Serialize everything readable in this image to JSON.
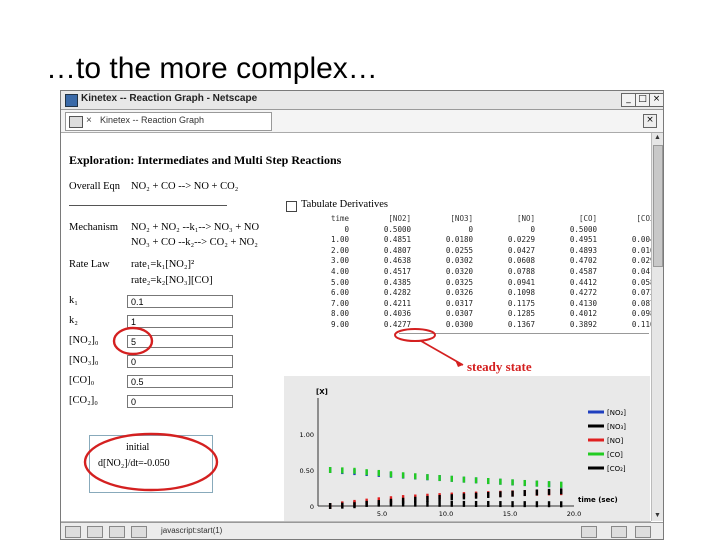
{
  "slide": {
    "title": "…to the more complex…"
  },
  "window": {
    "title": "Kinetex -- Reaction Graph - Netscape",
    "min": "_",
    "max": "□",
    "close": "×"
  },
  "tab": {
    "close": "×",
    "label": "Kinetex -- Reaction Graph",
    "closeall": "×"
  },
  "page": {
    "heading": "Exploration: Intermediates and Multi Step Reactions",
    "overall_label": "Overall Eqn",
    "overall_eqn": "NO₂ + CO --> NO + CO₂",
    "mechanism_label": "Mechanism",
    "mech1": "NO₂ + NO₂ --k₁--> NO₃ + NO",
    "mech2": "NO₃ + CO --k₂--> CO₂ + NO₂",
    "ratelaw_label": "Rate Law",
    "rate1": "rate₁=k₁[NO₂]²",
    "rate2": "rate₂=k₂[NO₃][CO]",
    "tabulate_label": "Tabulate Derivatives"
  },
  "inputs": [
    {
      "label": "k₁",
      "value": "0.1"
    },
    {
      "label": "k₂",
      "value": "1"
    },
    {
      "label": "[NO₂]₀",
      "value": "5"
    },
    {
      "label": "[NO₃]₀",
      "value": "0"
    },
    {
      "label": "[CO]₀",
      "value": "0.5"
    },
    {
      "label": "[CO₂]₀",
      "value": "0"
    }
  ],
  "table": {
    "headers": [
      "time",
      "[NO2]",
      "[NO3]",
      "[NO]",
      "[CO]",
      "[CO2]"
    ],
    "rows": [
      [
        "0",
        "0.5000",
        "0",
        "0",
        "0.5000",
        "0"
      ],
      [
        "1.00",
        "0.4851",
        "0.0180",
        "0.0229",
        "0.4951",
        "0.0049"
      ],
      [
        "2.00",
        "0.4807",
        "0.0255",
        "0.0427",
        "0.4893",
        "0.0107"
      ],
      [
        "3.00",
        "0.4638",
        "0.0302",
        "0.0608",
        "0.4702",
        "0.0298"
      ],
      [
        "4.00",
        "0.4517",
        "0.0320",
        "0.0788",
        "0.4587",
        "0.0413"
      ],
      [
        "5.00",
        "0.4385",
        "0.0325",
        "0.0941",
        "0.4412",
        "0.0588"
      ],
      [
        "6.00",
        "0.4282",
        "0.0326",
        "0.1098",
        "0.4272",
        "0.0728"
      ],
      [
        "7.00",
        "0.4211",
        "0.0317",
        "0.1175",
        "0.4130",
        "0.0870"
      ],
      [
        "8.00",
        "0.4036",
        "0.0307",
        "0.1285",
        "0.4012",
        "0.0988"
      ],
      [
        "9.00",
        "0.4277",
        "0.0300",
        "0.1367",
        "0.3892",
        "0.1108"
      ]
    ]
  },
  "annotation": {
    "steady_state": "steady state"
  },
  "chart_data": {
    "type": "line",
    "ylabel": "[X]",
    "xlabel": "time (sec)",
    "xlim": [
      0,
      20
    ],
    "ylim": [
      0,
      1.5
    ],
    "xticks": [
      "5.0",
      "10.0",
      "15.0",
      "20.0"
    ],
    "yticks": [
      "0",
      "0.50",
      "1.00"
    ],
    "series": [
      {
        "name": "[NO₂]",
        "color": "#1f3fbf",
        "values": [
          0.5,
          0.485,
          0.471,
          0.458,
          0.446,
          0.434,
          0.422,
          0.41,
          0.399,
          0.388,
          0.377,
          0.366,
          0.356,
          0.346,
          0.337,
          0.327,
          0.318,
          0.31,
          0.301,
          0.293
        ]
      },
      {
        "name": "[NO₃]",
        "color": "#000000",
        "values": [
          0.0,
          0.018,
          0.026,
          0.03,
          0.032,
          0.033,
          0.033,
          0.032,
          0.031,
          0.03,
          0.03,
          0.029,
          0.028,
          0.028,
          0.027,
          0.026,
          0.026,
          0.025,
          0.025,
          0.024
        ]
      },
      {
        "name": "[NO]",
        "color": "#e02020",
        "values": [
          0.0,
          0.023,
          0.043,
          0.061,
          0.079,
          0.094,
          0.11,
          0.118,
          0.129,
          0.137,
          0.145,
          0.152,
          0.159,
          0.165,
          0.17,
          0.175,
          0.18,
          0.184,
          0.188,
          0.192
        ]
      },
      {
        "name": "[CO]",
        "color": "#22cc22",
        "values": [
          0.5,
          0.495,
          0.489,
          0.47,
          0.459,
          0.441,
          0.427,
          0.413,
          0.401,
          0.389,
          0.378,
          0.367,
          0.357,
          0.347,
          0.338,
          0.329,
          0.32,
          0.312,
          0.304,
          0.296
        ]
      },
      {
        "name": "[CO₂]",
        "color": "#000000",
        "values": [
          0.0,
          0.005,
          0.011,
          0.03,
          0.041,
          0.059,
          0.073,
          0.087,
          0.099,
          0.111,
          0.122,
          0.133,
          0.143,
          0.153,
          0.162,
          0.171,
          0.18,
          0.188,
          0.196,
          0.204
        ]
      }
    ]
  },
  "initial": {
    "label": "initial",
    "value": "d[NO₂]/dt=-0.050"
  },
  "status": {
    "text": "javascript:start(1)"
  }
}
